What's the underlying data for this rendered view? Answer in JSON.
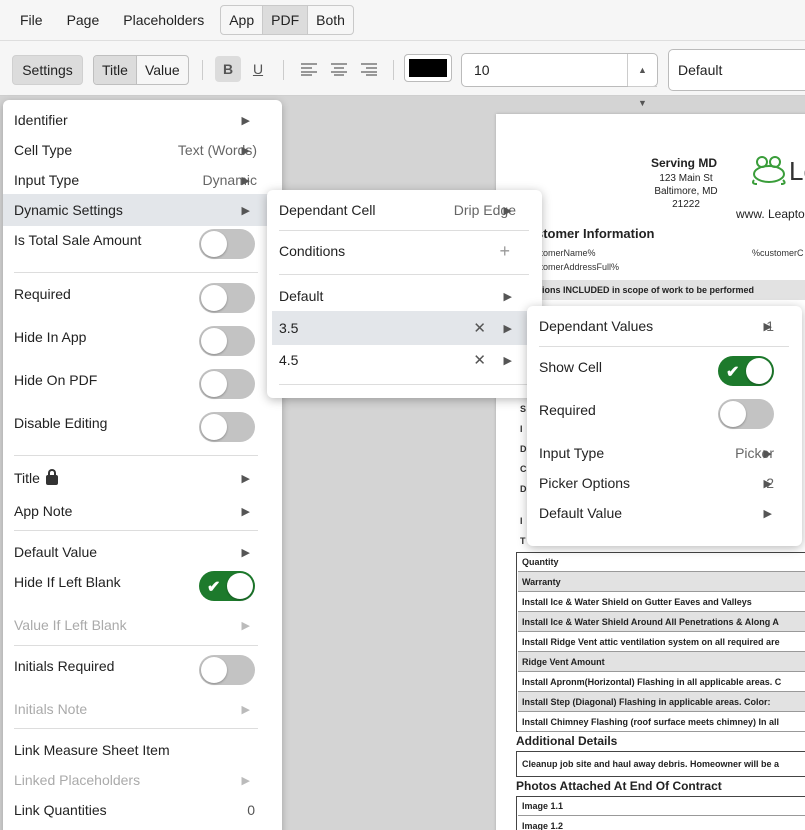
{
  "menubar": {
    "items": [
      "File",
      "Page",
      "Placeholders"
    ],
    "view_modes": [
      "App",
      "PDF",
      "Both"
    ],
    "active_view": "PDF"
  },
  "toolbar": {
    "settings_label": "Settings",
    "title_label": "Title",
    "value_label": "Value",
    "bold_label": "B",
    "underline_label": "U",
    "font_size": "10",
    "font_family": "Default",
    "text_color": "#000000"
  },
  "settings": {
    "identifier": "Identifier",
    "cell_type_label": "Cell Type",
    "cell_type_value": "Text (Words)",
    "input_type_label": "Input Type",
    "input_type_value": "Dynamic",
    "dynamic_settings": "Dynamic Settings",
    "is_total_sale": "Is Total Sale Amount",
    "required": "Required",
    "hide_in_app": "Hide In App",
    "hide_on_pdf": "Hide On PDF",
    "disable_editing": "Disable Editing",
    "title": "Title",
    "app_note": "App Note",
    "default_value": "Default Value",
    "hide_if_blank": "Hide If Left Blank",
    "value_if_blank": "Value If Left Blank",
    "initials_required": "Initials Required",
    "initials_note": "Initials Note",
    "link_measure": "Link Measure Sheet Item",
    "linked_placeholders": "Linked Placeholders",
    "link_quantities_label": "Link Quantities",
    "link_quantities_value": "0"
  },
  "dynamic_menu": {
    "dependant_cell_label": "Dependant Cell",
    "dependant_cell_value": "Drip Edge",
    "conditions": "Conditions",
    "default": "Default",
    "options": [
      "3.5",
      "4.5"
    ]
  },
  "option_menu": {
    "dependant_values_label": "Dependant Values",
    "dependant_values_count": "1",
    "show_cell": "Show Cell",
    "required": "Required",
    "input_type_label": "Input Type",
    "input_type_value": "Picker",
    "picker_options_label": "Picker Options",
    "picker_options_count": "2",
    "default_value": "Default Value"
  },
  "document": {
    "company": "Serving MD",
    "address_line1": "123 Main St",
    "address_line2": "Baltimore, MD 21222",
    "website": "www. Leapto",
    "logo_text": "Le",
    "customer_heading": "stomer Information",
    "customer_name": "stomerName%",
    "customer_right": "%customerC",
    "customer_address": "stomerAddressFull%",
    "scope_row": "ations INCLUDED in scope of work to be performed",
    "rows": [
      "Quantity",
      "Warranty",
      "Install Ice & Water Shield on Gutter Eaves and Valleys",
      "Install Ice & Water Shield Around All Penetrations & Along A",
      "Install Ridge Vent attic ventilation system on all required are",
      "Ridge Vent Amount",
      "Install Apronm(Horizontal) Flashing in all applicable areas. C",
      "Install Step (Diagonal) Flashing in applicable areas. Color:",
      "Install Chimney Flashing (roof surface meets chimney) In all"
    ],
    "additional_heading": "Additional Details",
    "additional_text": "Cleanup job site and haul away debris. Homeowner will be a",
    "photos_heading": "Photos Attached At End Of Contract",
    "photos": [
      "Image 1.1",
      "Image 1.2"
    ]
  }
}
